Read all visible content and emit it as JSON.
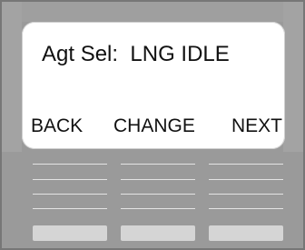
{
  "display": {
    "status_line": "Agt Sel:  LNG IDLE"
  },
  "softkeys": {
    "back": "BACK",
    "change": "CHANGE",
    "next": "NEXT"
  },
  "colors": {
    "housing": "#9a9a9a",
    "screen": "#ffffff",
    "button": "#d5d5d5",
    "text": "#111111"
  }
}
